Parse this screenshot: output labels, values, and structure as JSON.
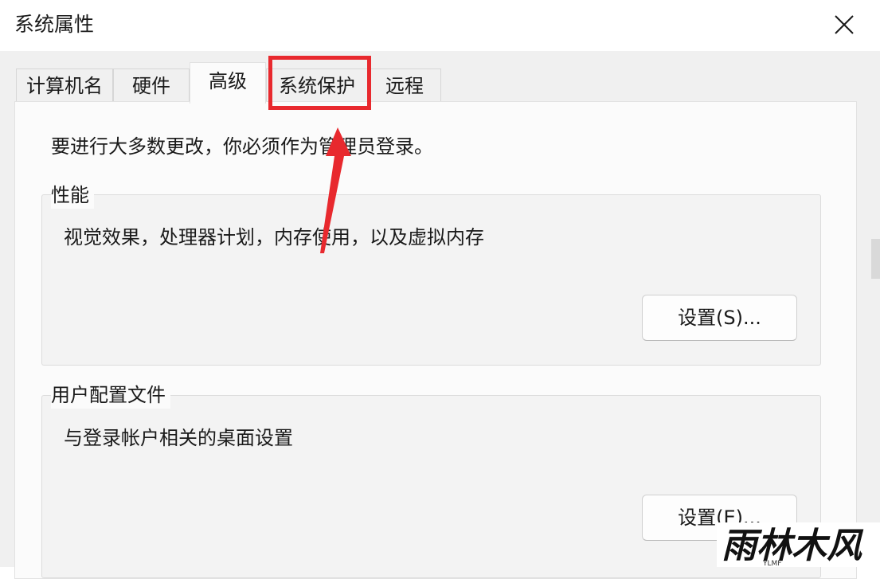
{
  "window": {
    "title": "系统属性"
  },
  "tabs": [
    {
      "label": "计算机名",
      "active": false
    },
    {
      "label": "硬件",
      "active": false
    },
    {
      "label": "高级",
      "active": true
    },
    {
      "label": "系统保护",
      "active": false,
      "highlighted": true
    },
    {
      "label": "远程",
      "active": false
    }
  ],
  "advanced": {
    "admin_note": "要进行大多数更改，你必须作为管理员登录。",
    "performance": {
      "title": "性能",
      "description": "视觉效果，处理器计划，内存使用，以及虚拟内存",
      "button_label": "设置(S)..."
    },
    "user_profiles": {
      "title": "用户配置文件",
      "description": "与登录帐户相关的桌面设置",
      "button_label": "设置(E)..."
    }
  },
  "annotation": {
    "highlight_color": "#e8292e",
    "target": "系统保护"
  },
  "watermark": {
    "text": "雨林木风",
    "subtext": "YLMF"
  },
  "icons": {
    "close": "close-icon",
    "arrow": "red-arrow-icon"
  }
}
